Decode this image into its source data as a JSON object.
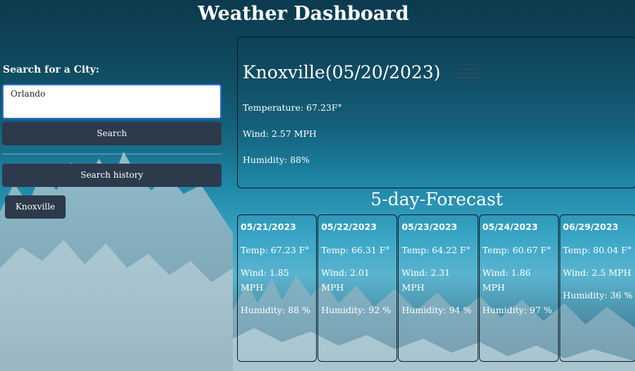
{
  "header": {
    "title": "Weather Dashboard"
  },
  "search": {
    "label": "Search for a City:",
    "input_value": "Orlando",
    "search_button": "Search",
    "history_button": "Search history",
    "history_items": [
      "Knoxville"
    ]
  },
  "current": {
    "city_date": "Knoxville(05/20/2023)",
    "icon": "haze-icon",
    "temperature": "Temperature: 67.23F°",
    "wind": "Wind: 2.57 MPH",
    "humidity": "Humidity: 88%"
  },
  "forecast": {
    "title": "5-day-Forecast",
    "days": [
      {
        "date": "05/21/2023",
        "temp": "Temp: 67.23 F°",
        "wind": "Wind: 1.85 MPH",
        "humidity": "Humidity: 88 %"
      },
      {
        "date": "05/22/2023",
        "temp": "Temp: 66.31 F°",
        "wind": "Wind: 2.01 MPH",
        "humidity": "Humidity: 92 %"
      },
      {
        "date": "05/23/2023",
        "temp": "Temp: 64.22 F°",
        "wind": "Wind: 2.31 MPH",
        "humidity": "Humidity: 94 %"
      },
      {
        "date": "05/24/2023",
        "temp": "Temp: 60.67 F°",
        "wind": "Wind: 1.86 MPH",
        "humidity": "Humidity: 97 %"
      },
      {
        "date": "06/29/2023",
        "temp": "Temp: 80.04 F°",
        "wind": "Wind: 2.5 MPH",
        "humidity": "Humidity: 36 %"
      }
    ]
  },
  "colors": {
    "button_bg": "#2c3a4b",
    "input_border": "#2e6fd6",
    "panel_border": "#0a1a22"
  }
}
